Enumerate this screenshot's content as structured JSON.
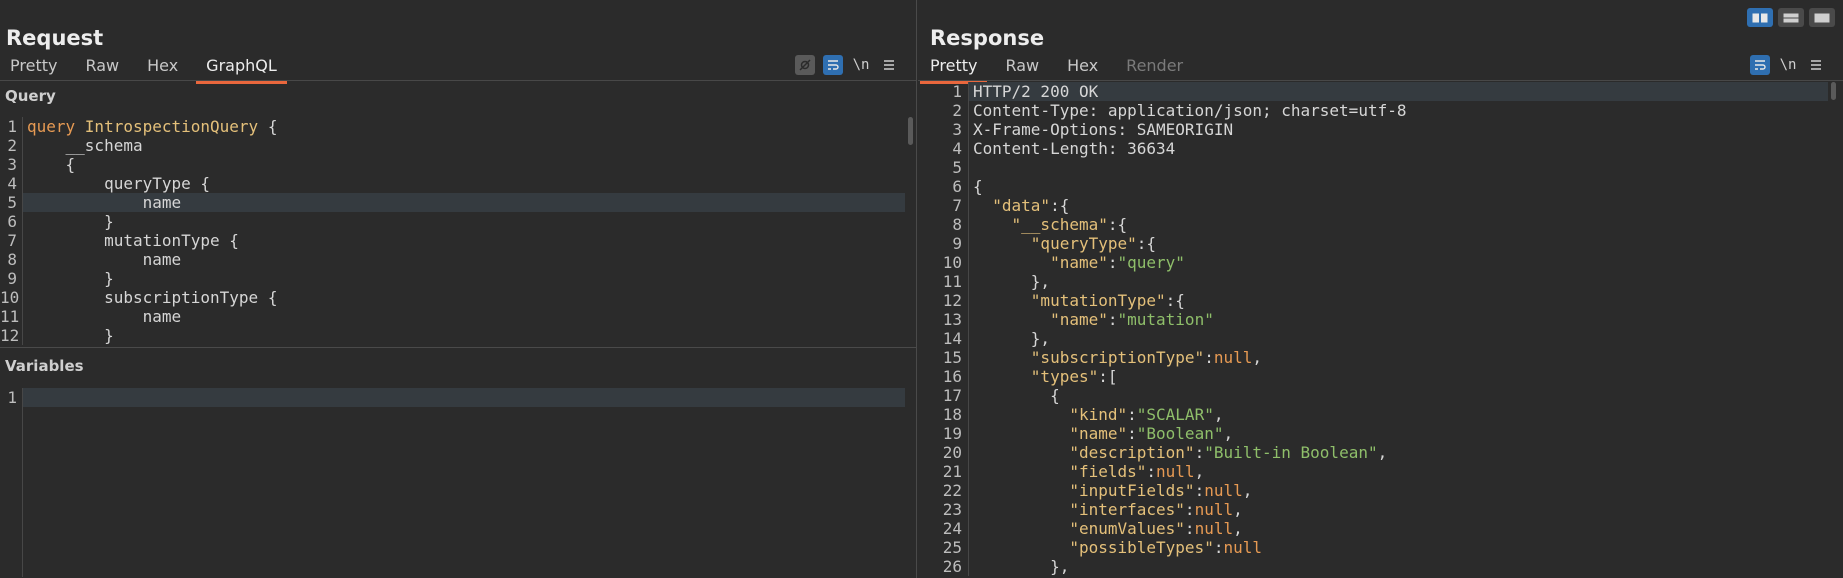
{
  "request": {
    "title": "Request",
    "tabs": [
      "Pretty",
      "Raw",
      "Hex",
      "GraphQL"
    ],
    "query_label": "Query",
    "variables_label": "Variables",
    "wrap_tool": "\\n",
    "query_lines": [
      {
        "n": "1",
        "indent": "",
        "parts": [
          {
            "t": "query ",
            "c": "kw"
          },
          {
            "t": "IntrospectionQuery",
            "c": "id"
          },
          {
            "t": " {",
            "c": ""
          }
        ]
      },
      {
        "n": "2",
        "indent": "    ",
        "parts": [
          {
            "t": "__schema",
            "c": ""
          }
        ]
      },
      {
        "n": "3",
        "indent": "    ",
        "parts": [
          {
            "t": "{",
            "c": ""
          }
        ]
      },
      {
        "n": "4",
        "indent": "        ",
        "parts": [
          {
            "t": "queryType {",
            "c": ""
          }
        ]
      },
      {
        "n": "5",
        "indent": "            ",
        "parts": [
          {
            "t": "name",
            "c": ""
          }
        ]
      },
      {
        "n": "6",
        "indent": "        ",
        "parts": [
          {
            "t": "}",
            "c": ""
          }
        ]
      },
      {
        "n": "7",
        "indent": "        ",
        "parts": [
          {
            "t": "mutationType {",
            "c": ""
          }
        ]
      },
      {
        "n": "8",
        "indent": "            ",
        "parts": [
          {
            "t": "name",
            "c": ""
          }
        ]
      },
      {
        "n": "9",
        "indent": "        ",
        "parts": [
          {
            "t": "}",
            "c": ""
          }
        ]
      },
      {
        "n": "10",
        "indent": "        ",
        "parts": [
          {
            "t": "subscriptionType {",
            "c": ""
          }
        ]
      },
      {
        "n": "11",
        "indent": "            ",
        "parts": [
          {
            "t": "name",
            "c": ""
          }
        ]
      },
      {
        "n": "12",
        "indent": "        ",
        "parts": [
          {
            "t": "}",
            "c": ""
          }
        ]
      }
    ],
    "variable_lines": [
      {
        "n": "1",
        "indent": "",
        "parts": []
      }
    ]
  },
  "response": {
    "title": "Response",
    "tabs": [
      "Pretty",
      "Raw",
      "Hex",
      "Render"
    ],
    "wrap_tool": "\\n",
    "lines": [
      {
        "n": "1",
        "indent": "",
        "parts": [
          {
            "t": "HTTP/2 200 OK",
            "c": ""
          }
        ]
      },
      {
        "n": "2",
        "indent": "",
        "parts": [
          {
            "t": "Content-Type: application/json; charset=utf-8",
            "c": ""
          }
        ]
      },
      {
        "n": "3",
        "indent": "",
        "parts": [
          {
            "t": "X-Frame-Options: SAMEORIGIN",
            "c": ""
          }
        ]
      },
      {
        "n": "4",
        "indent": "",
        "parts": [
          {
            "t": "Content-Length: 36634",
            "c": ""
          }
        ]
      },
      {
        "n": "5",
        "indent": "",
        "parts": []
      },
      {
        "n": "6",
        "indent": "",
        "parts": [
          {
            "t": "{",
            "c": ""
          }
        ]
      },
      {
        "n": "7",
        "indent": "  ",
        "parts": [
          {
            "t": "\"data\"",
            "c": "key"
          },
          {
            "t": ":{",
            "c": ""
          }
        ]
      },
      {
        "n": "8",
        "indent": "    ",
        "parts": [
          {
            "t": "\"__schema\"",
            "c": "key"
          },
          {
            "t": ":{",
            "c": ""
          }
        ]
      },
      {
        "n": "9",
        "indent": "      ",
        "parts": [
          {
            "t": "\"queryType\"",
            "c": "key"
          },
          {
            "t": ":{",
            "c": ""
          }
        ]
      },
      {
        "n": "10",
        "indent": "        ",
        "parts": [
          {
            "t": "\"name\"",
            "c": "key"
          },
          {
            "t": ":",
            "c": ""
          },
          {
            "t": "\"query\"",
            "c": "str"
          }
        ]
      },
      {
        "n": "11",
        "indent": "      ",
        "parts": [
          {
            "t": "},",
            "c": ""
          }
        ]
      },
      {
        "n": "12",
        "indent": "      ",
        "parts": [
          {
            "t": "\"mutationType\"",
            "c": "key"
          },
          {
            "t": ":{",
            "c": ""
          }
        ]
      },
      {
        "n": "13",
        "indent": "        ",
        "parts": [
          {
            "t": "\"name\"",
            "c": "key"
          },
          {
            "t": ":",
            "c": ""
          },
          {
            "t": "\"mutation\"",
            "c": "str"
          }
        ]
      },
      {
        "n": "14",
        "indent": "      ",
        "parts": [
          {
            "t": "},",
            "c": ""
          }
        ]
      },
      {
        "n": "15",
        "indent": "      ",
        "parts": [
          {
            "t": "\"subscriptionType\"",
            "c": "key"
          },
          {
            "t": ":",
            "c": ""
          },
          {
            "t": "null",
            "c": "nul"
          },
          {
            "t": ",",
            "c": ""
          }
        ]
      },
      {
        "n": "16",
        "indent": "      ",
        "parts": [
          {
            "t": "\"types\"",
            "c": "key"
          },
          {
            "t": ":[",
            "c": ""
          }
        ]
      },
      {
        "n": "17",
        "indent": "        ",
        "parts": [
          {
            "t": "{",
            "c": ""
          }
        ]
      },
      {
        "n": "18",
        "indent": "          ",
        "parts": [
          {
            "t": "\"kind\"",
            "c": "key"
          },
          {
            "t": ":",
            "c": ""
          },
          {
            "t": "\"SCALAR\"",
            "c": "str"
          },
          {
            "t": ",",
            "c": ""
          }
        ]
      },
      {
        "n": "19",
        "indent": "          ",
        "parts": [
          {
            "t": "\"name\"",
            "c": "key"
          },
          {
            "t": ":",
            "c": ""
          },
          {
            "t": "\"Boolean\"",
            "c": "str"
          },
          {
            "t": ",",
            "c": ""
          }
        ]
      },
      {
        "n": "20",
        "indent": "          ",
        "parts": [
          {
            "t": "\"description\"",
            "c": "key"
          },
          {
            "t": ":",
            "c": ""
          },
          {
            "t": "\"Built-in Boolean\"",
            "c": "str"
          },
          {
            "t": ",",
            "c": ""
          }
        ]
      },
      {
        "n": "21",
        "indent": "          ",
        "parts": [
          {
            "t": "\"fields\"",
            "c": "key"
          },
          {
            "t": ":",
            "c": ""
          },
          {
            "t": "null",
            "c": "nul"
          },
          {
            "t": ",",
            "c": ""
          }
        ]
      },
      {
        "n": "22",
        "indent": "          ",
        "parts": [
          {
            "t": "\"inputFields\"",
            "c": "key"
          },
          {
            "t": ":",
            "c": ""
          },
          {
            "t": "null",
            "c": "nul"
          },
          {
            "t": ",",
            "c": ""
          }
        ]
      },
      {
        "n": "23",
        "indent": "          ",
        "parts": [
          {
            "t": "\"interfaces\"",
            "c": "key"
          },
          {
            "t": ":",
            "c": ""
          },
          {
            "t": "null",
            "c": "nul"
          },
          {
            "t": ",",
            "c": ""
          }
        ]
      },
      {
        "n": "24",
        "indent": "          ",
        "parts": [
          {
            "t": "\"enumValues\"",
            "c": "key"
          },
          {
            "t": ":",
            "c": ""
          },
          {
            "t": "null",
            "c": "nul"
          },
          {
            "t": ",",
            "c": ""
          }
        ]
      },
      {
        "n": "25",
        "indent": "          ",
        "parts": [
          {
            "t": "\"possibleTypes\"",
            "c": "key"
          },
          {
            "t": ":",
            "c": ""
          },
          {
            "t": "null",
            "c": "nul"
          }
        ]
      },
      {
        "n": "26",
        "indent": "        ",
        "parts": [
          {
            "t": "},",
            "c": ""
          }
        ]
      }
    ]
  },
  "colors": {
    "accent_tab": "#e9673d",
    "tool_blue": "#2f6fb1",
    "key": "#e4c07a",
    "string": "#8fbf6a",
    "keyword": "#e79a53"
  },
  "icons": [
    "hide-icon",
    "wrap-lines-icon",
    "newline-icon",
    "menu-icon",
    "layout-side-by-side-icon",
    "layout-stacked-icon",
    "layout-single-icon"
  ]
}
